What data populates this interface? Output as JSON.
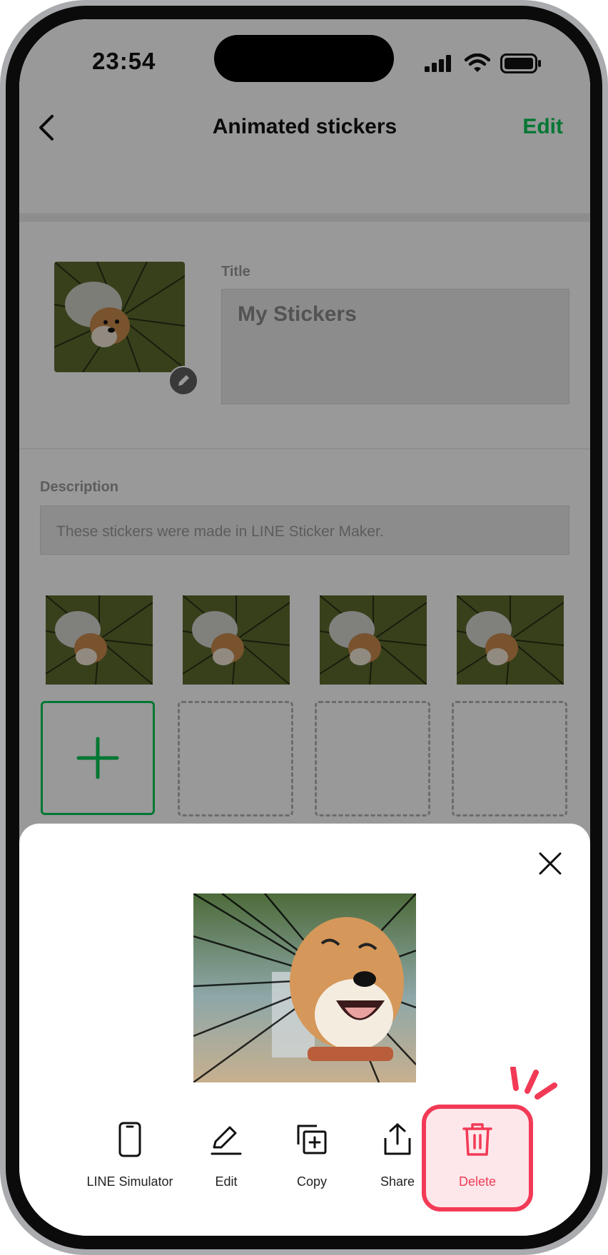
{
  "status": {
    "time": "23:54"
  },
  "nav": {
    "title": "Animated stickers",
    "edit_label": "Edit"
  },
  "form": {
    "title_label": "Title",
    "title_value": "My Stickers",
    "description_label": "Description",
    "description_value": "These stickers were made in LINE Sticker Maker."
  },
  "stickers": {
    "count_shown": 4,
    "empty_slots": 3
  },
  "sheet": {
    "actions": [
      {
        "label": "LINE Simulator",
        "icon": "phone-icon"
      },
      {
        "label": "Edit",
        "icon": "pencil-icon"
      },
      {
        "label": "Copy",
        "icon": "copy-icon"
      },
      {
        "label": "Share",
        "icon": "share-icon"
      },
      {
        "label": "Delete",
        "icon": "trash-icon"
      }
    ]
  },
  "colors": {
    "accent_green": "#06c755",
    "delete_red": "#f23a56"
  }
}
